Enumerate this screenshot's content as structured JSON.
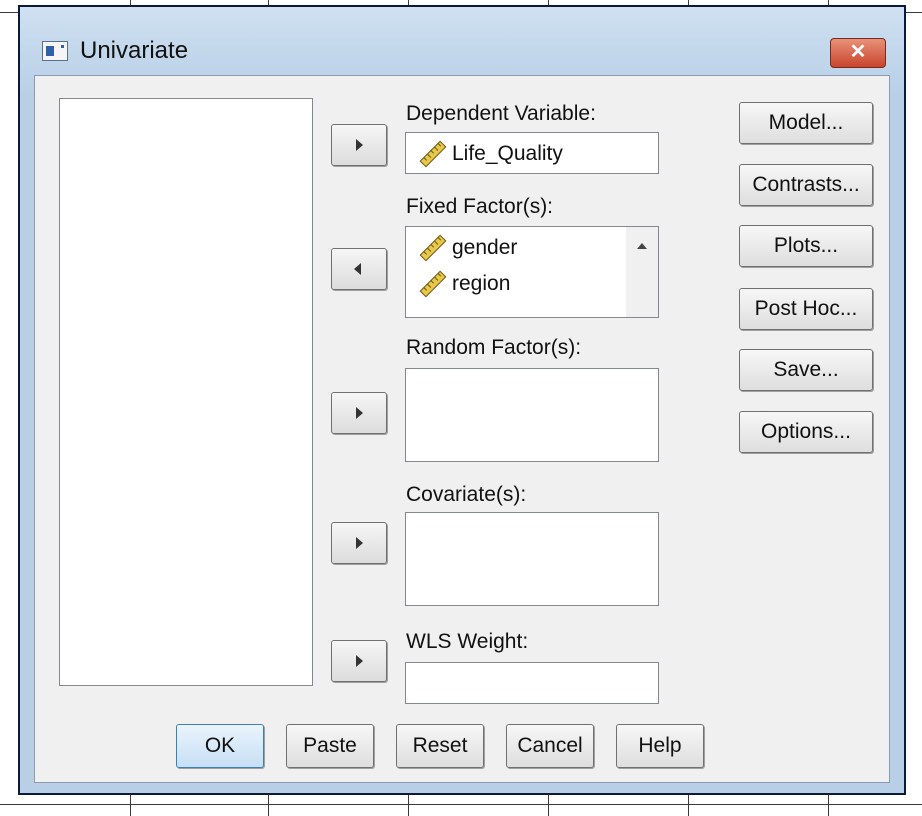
{
  "window": {
    "title": "Univariate",
    "close_label": "✕"
  },
  "source_list": {
    "items": []
  },
  "dependent": {
    "label": "Dependent Variable:",
    "value": "Life_Quality"
  },
  "fixed_factors": {
    "label": "Fixed Factor(s):",
    "items": [
      "gender",
      "region"
    ]
  },
  "random_factors": {
    "label": "Random Factor(s):",
    "items": []
  },
  "covariates": {
    "label": "Covariate(s):",
    "items": []
  },
  "wls_weight": {
    "label": "WLS Weight:",
    "value": ""
  },
  "side_buttons": {
    "model": "Model...",
    "contrasts": "Contrasts...",
    "plots": "Plots...",
    "post_hoc": "Post Hoc...",
    "save": "Save...",
    "options": "Options..."
  },
  "bottom_buttons": {
    "ok": "OK",
    "paste": "Paste",
    "reset": "Reset",
    "cancel": "Cancel",
    "help": "Help"
  },
  "icons": {
    "variable": "ruler-scale-icon",
    "arrow_right": "arrow-right-icon",
    "arrow_left": "arrow-left-icon"
  },
  "colors": {
    "titlebar": "#b9d0e7",
    "close_button": "#c8452c",
    "dialog_body": "#f0f0f0",
    "default_button": "#c6dff5"
  }
}
